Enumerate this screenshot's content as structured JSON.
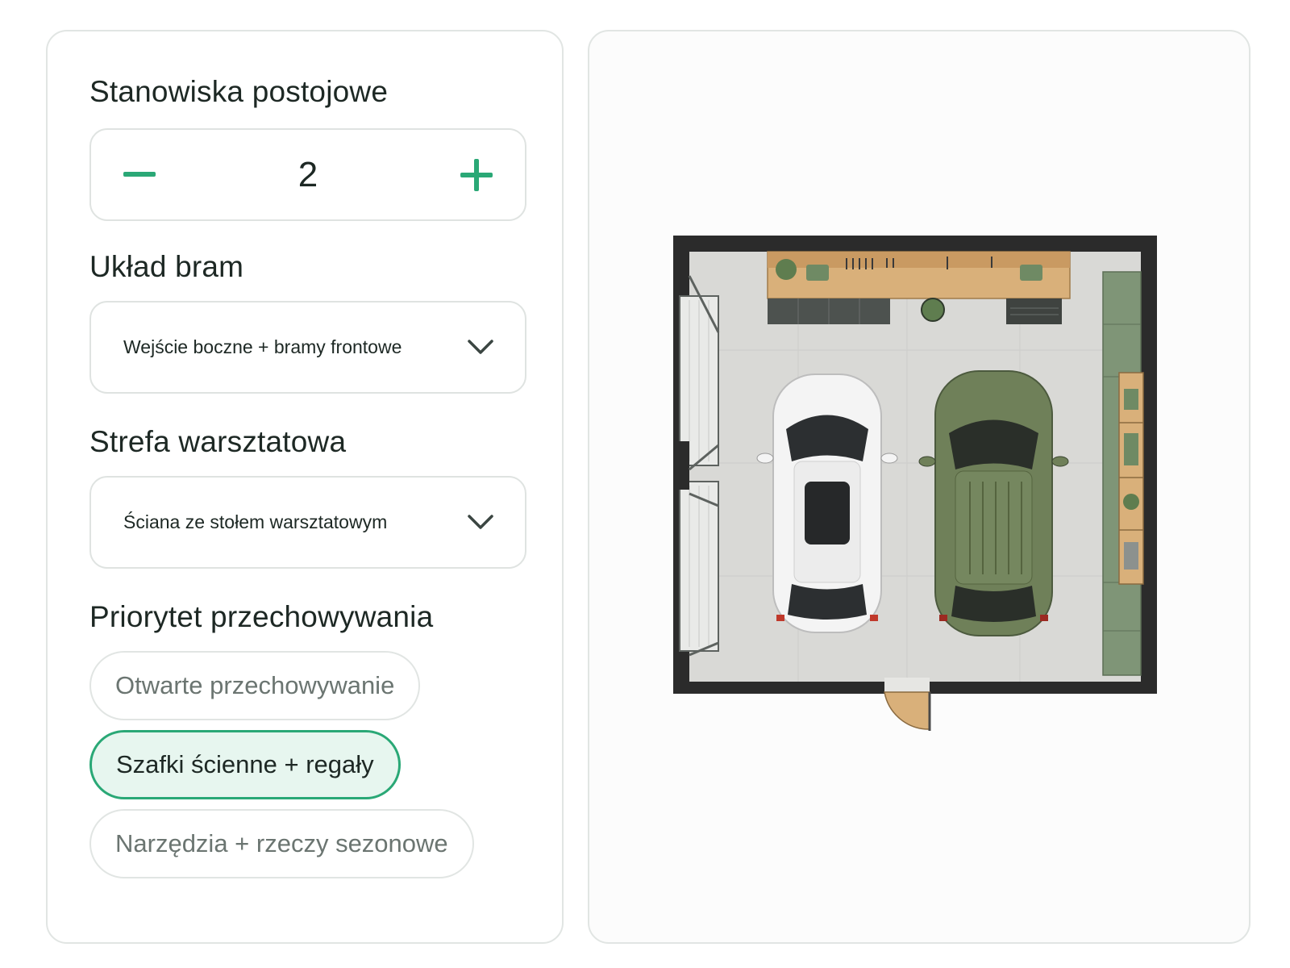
{
  "colors": {
    "accent": "#2aa876",
    "chip_selected_bg": "#e7f6ef",
    "wall": "#2b2b2b",
    "floor": "#d9d9d6",
    "wood": "#d9b07a",
    "cabinet_green": "#7f9577",
    "car_green": "#6f8059",
    "car_white": "#f4f4f4"
  },
  "parking": {
    "title": "Stanowiska postojowe",
    "value": "2",
    "decrement_icon": "minus-icon",
    "increment_icon": "plus-icon"
  },
  "gates": {
    "title": "Układ bram",
    "selected": "Wejście boczne + bramy frontowe",
    "icon": "chevron-down-icon"
  },
  "workshop": {
    "title": "Strefa warsztatowa",
    "selected": "Ściana ze stołem warsztatowym",
    "icon": "chevron-down-icon"
  },
  "storage": {
    "title": "Priorytet przechowywania",
    "options": [
      {
        "label": "Otwarte przechowywanie",
        "selected": false
      },
      {
        "label": "Szafki ścienne + regały",
        "selected": true
      },
      {
        "label": "Narzędzia + rzeczy sezonowe",
        "selected": false
      }
    ]
  }
}
